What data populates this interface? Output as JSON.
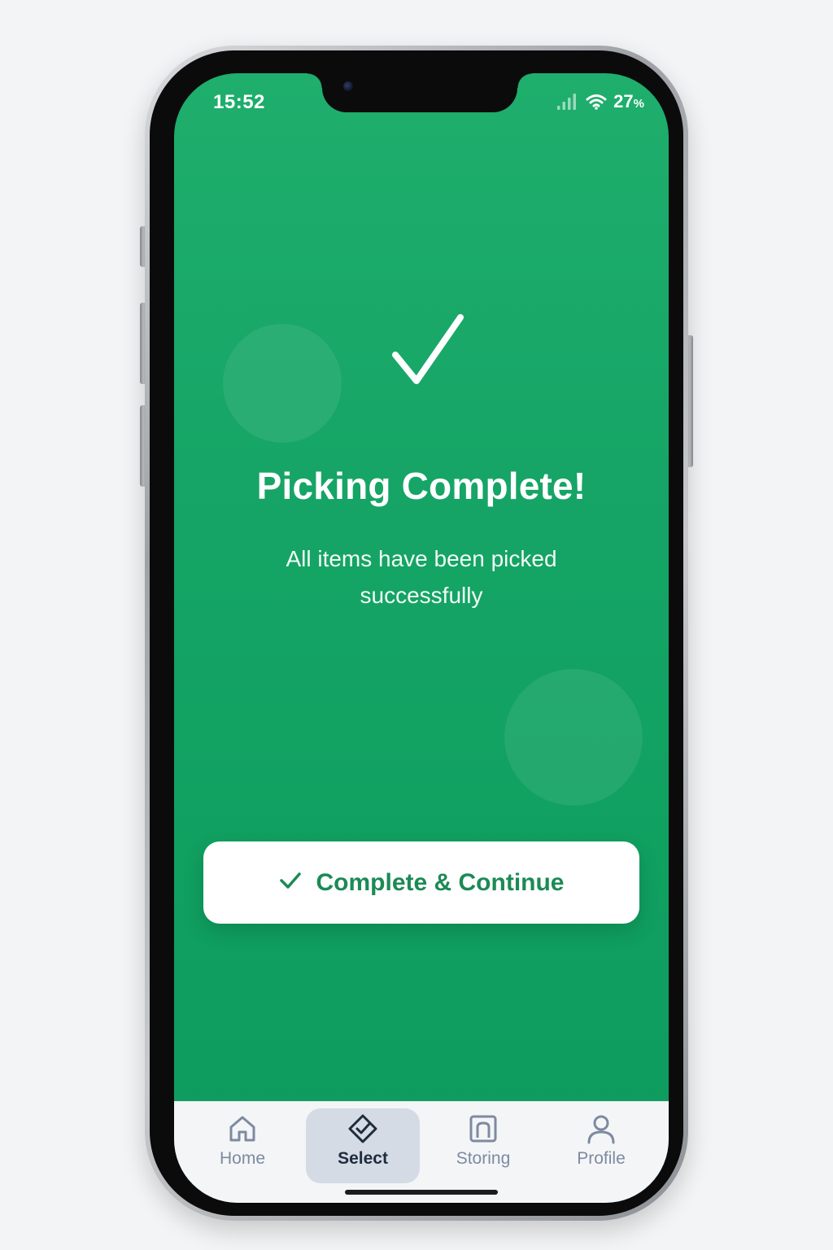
{
  "status_bar": {
    "time": "15:52",
    "battery": "27",
    "battery_unit": "%",
    "signal_icon": "cellular-signal-icon",
    "wifi_icon": "wifi-icon"
  },
  "main": {
    "icon": "checkmark-icon",
    "title": "Picking Complete!",
    "subtitle": "All items have been picked successfully"
  },
  "cta": {
    "icon": "checkmark-icon",
    "label": "Complete & Continue"
  },
  "tabbar": {
    "active": "Select",
    "items": [
      {
        "label": "Home",
        "icon": "home-icon"
      },
      {
        "label": "Select",
        "icon": "select-check-icon"
      },
      {
        "label": "Storing",
        "icon": "storing-icon"
      },
      {
        "label": "Profile",
        "icon": "profile-icon"
      }
    ]
  },
  "colors": {
    "background_green": "#16a566",
    "cta_text": "#1c8a55",
    "tab_active_bg": "#d4dbe4",
    "tab_inactive": "#7d8aa0",
    "tab_active_text": "#1f2b3d"
  }
}
